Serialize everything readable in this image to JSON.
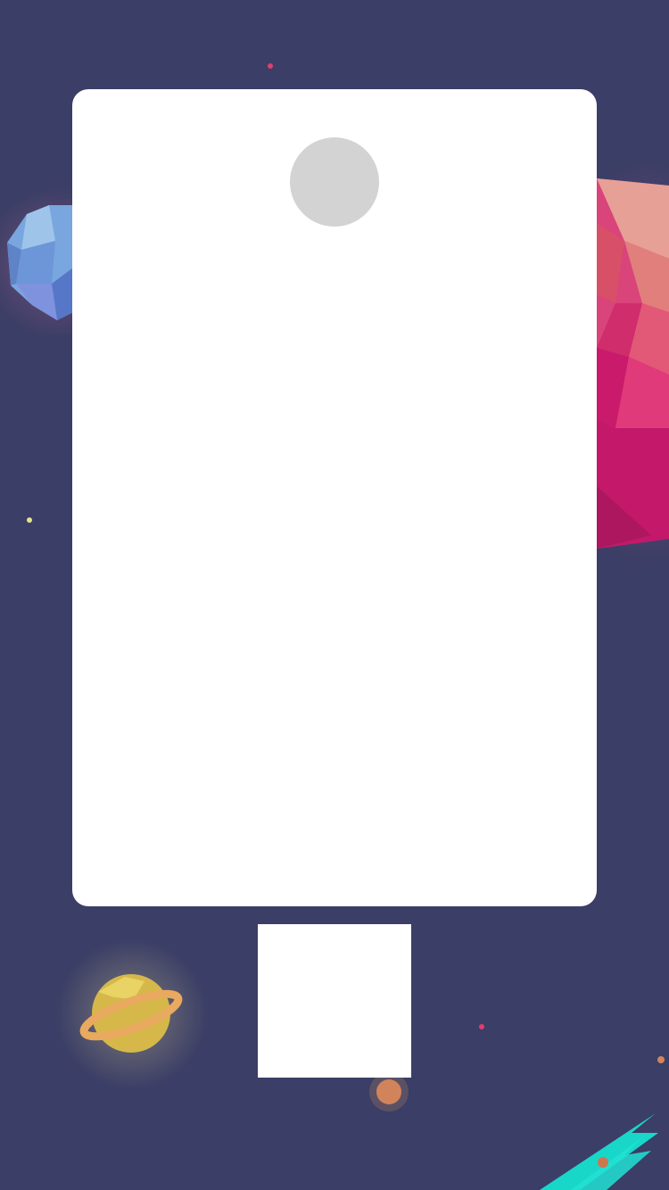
{
  "theme": {
    "background": "#3b3e66",
    "card": "#ffffff",
    "avatar_placeholder": "#d3d3d3"
  },
  "decorations": {
    "left_planet": "blue-crystal-planet",
    "right_planet": "pink-crystal-planet",
    "bottom_left_planet": "yellow-ringed-planet",
    "comet": "cyan-comet"
  },
  "card": {
    "avatar_icon": "avatar-placeholder"
  },
  "bottom_box": {
    "icon": "qr-code-placeholder"
  }
}
